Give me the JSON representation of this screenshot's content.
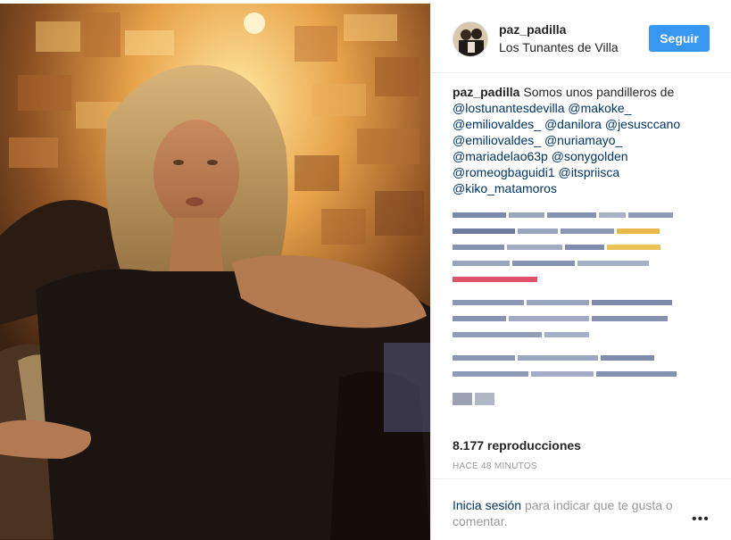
{
  "post": {
    "username": "paz_padilla",
    "location": "Los Tunantes de Villa",
    "follow_label": "Seguir",
    "caption_author": "paz_padilla",
    "caption_text": "Somos unos pandilleros de",
    "mentions": [
      "@lostunantesdevilla",
      "@makoke_",
      "@emiliovaldes_",
      "@danilora",
      "@jesusccano",
      "@emiliovaldes_",
      "@nuriamayo_",
      "@mariadelao63p",
      "@sonygolden",
      "@romeogbaguidi1",
      "@itspriisca",
      "@kiko_matamoros"
    ],
    "views": "8.177 reproducciones",
    "timestamp": "HACE 48 MINUTOS",
    "login_link": "Inicia sesión",
    "login_rest": "para indicar que te gusta o comentar.",
    "more_label": "•••"
  },
  "colors": {
    "accent": "#3897f0",
    "link": "#003569",
    "muted": "#999999",
    "text": "#262626"
  }
}
